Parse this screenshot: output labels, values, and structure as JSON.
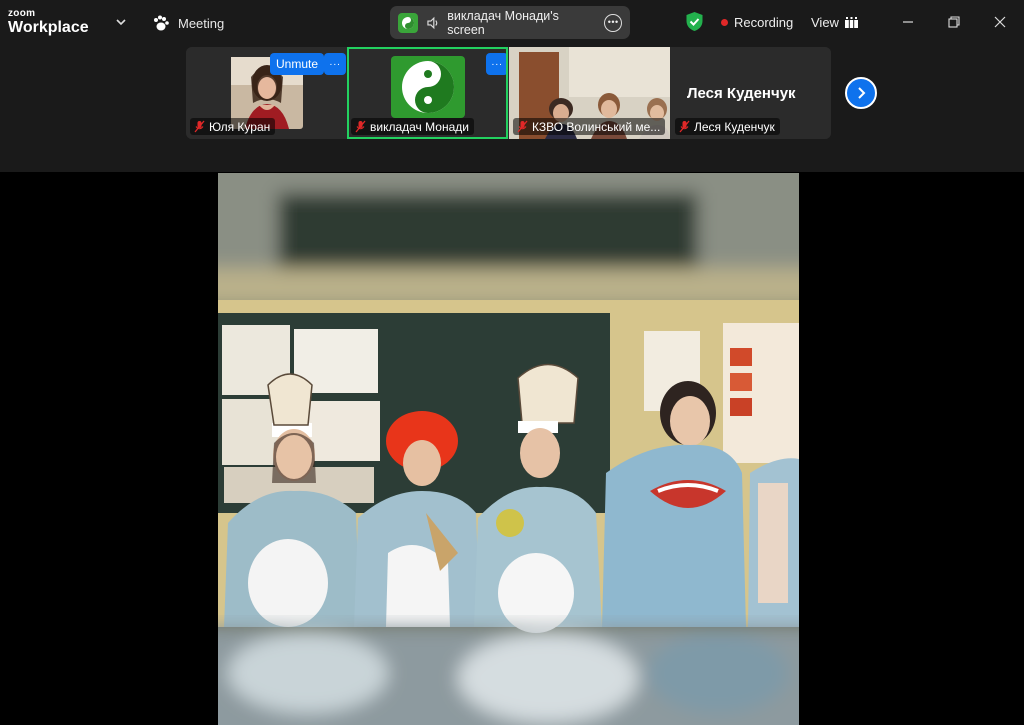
{
  "titlebar": {
    "logo_top": "zoom",
    "logo_bottom": "Workplace",
    "meeting_label": "Meeting",
    "share_label": "викладач Монади's screen",
    "recording_label": "Recording",
    "view_label": "View"
  },
  "participants": [
    {
      "name": "Юля Куран",
      "muted": true,
      "unmute_label": "Unmute",
      "more_label": "···"
    },
    {
      "name": "викладач Монади",
      "muted": true,
      "more_label": "···",
      "active": true
    },
    {
      "name": "КЗВО Волинський ме...",
      "muted": true
    },
    {
      "name": "Леся Куденчук",
      "display_name": "Леся Куденчук",
      "muted": true
    }
  ],
  "colors": {
    "accent": "#0e72ed",
    "active_border": "#23d160",
    "recording": "#e02828",
    "shield": "#23b14d",
    "app_bg": "#1a1a1a"
  },
  "icons": [
    "chevron-down-icon",
    "paw-icon",
    "speaker-icon",
    "more-icon",
    "shield-check-icon",
    "record-dot-icon",
    "view-grid-icon",
    "minimize-icon",
    "restore-icon",
    "close-icon",
    "mic-off-icon",
    "chevron-right-icon",
    "yin-yang-icon"
  ]
}
